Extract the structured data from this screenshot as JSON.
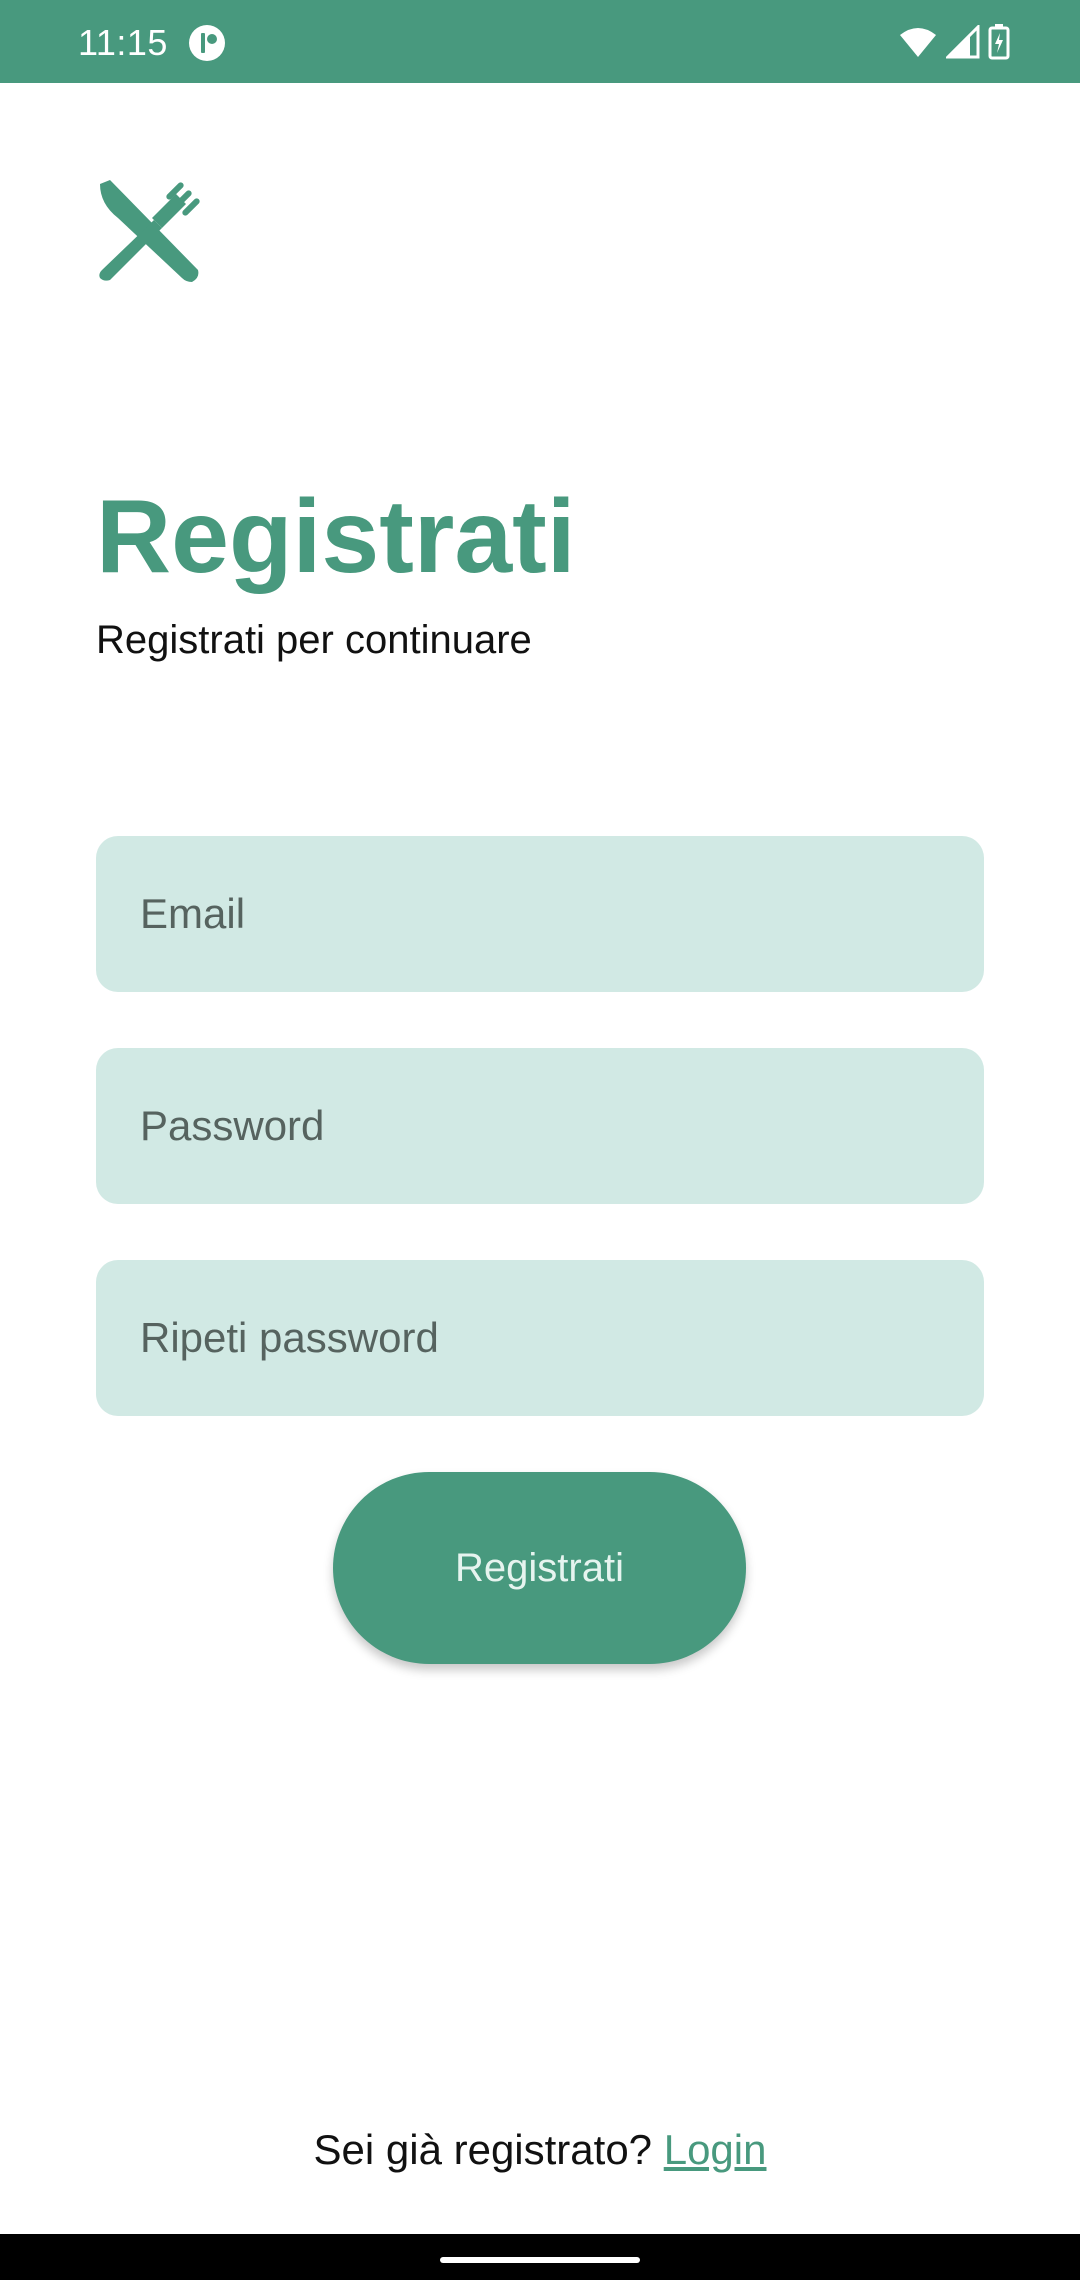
{
  "status_bar": {
    "time": "11:15",
    "app_icon": "app-notification-icon",
    "icons": [
      "wifi-icon",
      "signal-icon",
      "battery-charging-icon"
    ]
  },
  "colors": {
    "accent": "#48997e",
    "input_background": "#d1e9e4",
    "text": "#111111"
  },
  "logo": {
    "icon": "knife-fork-icon"
  },
  "header": {
    "title": "Registrati",
    "subtitle": "Registrati per continuare"
  },
  "form": {
    "email_placeholder": "Email",
    "password_placeholder": "Password",
    "repeat_password_placeholder": "Ripeti password",
    "submit_label": "Registrati"
  },
  "footer": {
    "prompt": "Sei già registrato?",
    "login_label": "Login"
  }
}
